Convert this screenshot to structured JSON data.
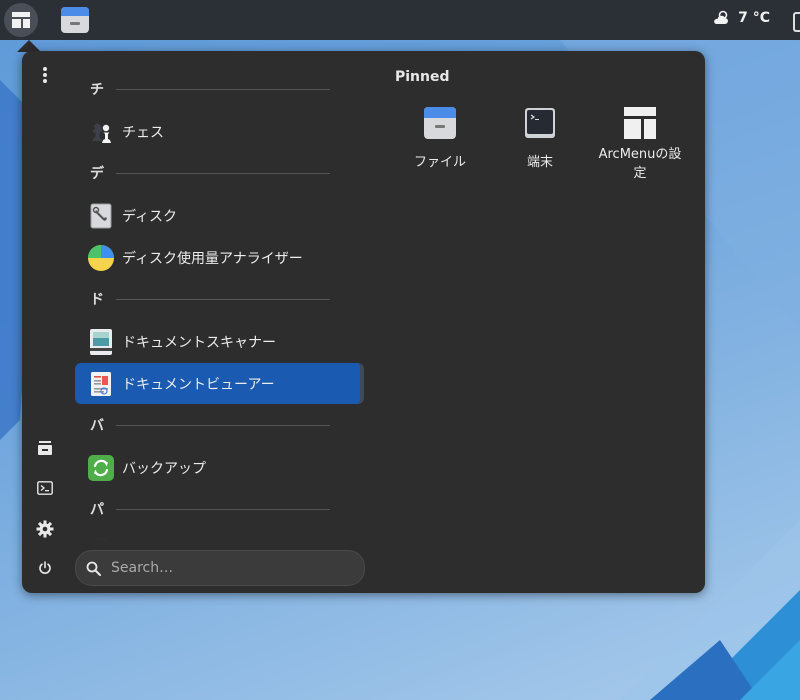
{
  "top_panel": {
    "arcmenu_icon": "arcmenu-layout-icon",
    "files_icon": "files-app-icon",
    "weather": {
      "icon": "cloud-sun-icon",
      "temperature": "7 °C"
    }
  },
  "menu": {
    "side_actions": [
      {
        "name": "more-options-icon"
      },
      {
        "name": "files-shortcut-icon"
      },
      {
        "name": "terminal-shortcut-icon"
      },
      {
        "name": "settings-gear-icon"
      },
      {
        "name": "power-icon"
      }
    ],
    "app_groups": [
      {
        "letter": "チ",
        "apps": [
          {
            "label": "チェス",
            "icon": "chess-icon"
          }
        ]
      },
      {
        "letter": "デ",
        "apps": [
          {
            "label": "ディスク",
            "icon": "disks-icon"
          },
          {
            "label": "ディスク使用量アナライザー",
            "icon": "disk-usage-icon"
          }
        ]
      },
      {
        "letter": "ド",
        "apps": [
          {
            "label": "ドキュメントスキャナー",
            "icon": "scanner-icon"
          },
          {
            "label": "ドキュメントビューアー",
            "icon": "document-viewer-icon",
            "selected": true
          }
        ]
      },
      {
        "letter": "バ",
        "apps": [
          {
            "label": "バックアップ",
            "icon": "backup-icon"
          }
        ]
      },
      {
        "letter": "パ",
        "apps": []
      }
    ],
    "search": {
      "placeholder": "Search…",
      "value": ""
    },
    "pinned": {
      "title": "Pinned",
      "items": [
        {
          "label": "ファイル",
          "icon": "files-icon"
        },
        {
          "label": "端末",
          "icon": "terminal-icon"
        },
        {
          "label": "ArcMenuの設定",
          "icon": "arcmenu-settings-icon"
        }
      ]
    }
  },
  "colors": {
    "accent": "#1a5ab0",
    "menu_bg": "#2d2d2d",
    "panel_bg": "#2b2f36"
  }
}
